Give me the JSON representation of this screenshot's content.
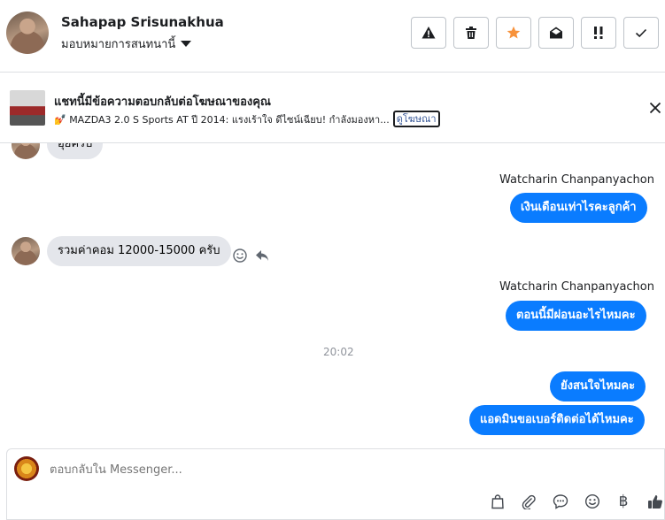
{
  "header": {
    "name": "Sahapap Srisunakhua",
    "assign_label": "มอบหมายการสนทนานี้",
    "actions": [
      {
        "name": "spam",
        "icon": "warning-icon"
      },
      {
        "name": "delete",
        "icon": "trash-icon"
      },
      {
        "name": "follow-up",
        "icon": "star-icon",
        "color": "#f7923b"
      },
      {
        "name": "mark-unread",
        "icon": "envelope-open-icon"
      },
      {
        "name": "priority",
        "icon": "exclamation-icon"
      },
      {
        "name": "done",
        "icon": "check-icon"
      }
    ]
  },
  "ad_banner": {
    "title": "แชทนี้มีข้อความตอบกลับต่อโฆษณาของคุณ",
    "description": "💅 MAZDA3 2.0 S Sports AT ปี 2014: แรงเร้าใจ ดีไซน์เฉียบ! กำลังมองหา...",
    "link_label": "ดูโฆษณา",
    "close_icon": "close-icon"
  },
  "messages": {
    "partial_incoming": "อุ๊ยครับ",
    "sender_1": "Watcharin Chanpanyachon",
    "outgoing_1": "เงินเดือนเท่าไรคะลูกค้า",
    "incoming_1": "รวมค่าคอม 12000-15000 ครับ",
    "sender_2": "Watcharin Chanpanyachon",
    "outgoing_2": "ตอนนี้มีผ่อนอะไรไหมคะ",
    "timestamp": "20:02",
    "outgoing_3": "ยังสนใจไหมคะ",
    "outgoing_4": "แอดมินขอเบอร์ติดต่อได้ไหมคะ"
  },
  "composer": {
    "placeholder": "ตอบกลับใน Messenger...",
    "icons": [
      "shopping-bag-icon",
      "paperclip-icon",
      "chat-bubble-icon",
      "emoji-icon",
      "baht-icon",
      "thumbs-up-icon"
    ],
    "baht_symbol": "฿"
  },
  "colors": {
    "accent": "#0a7cff",
    "incoming_bubble": "#e4e6eb",
    "star": "#f7923b"
  }
}
